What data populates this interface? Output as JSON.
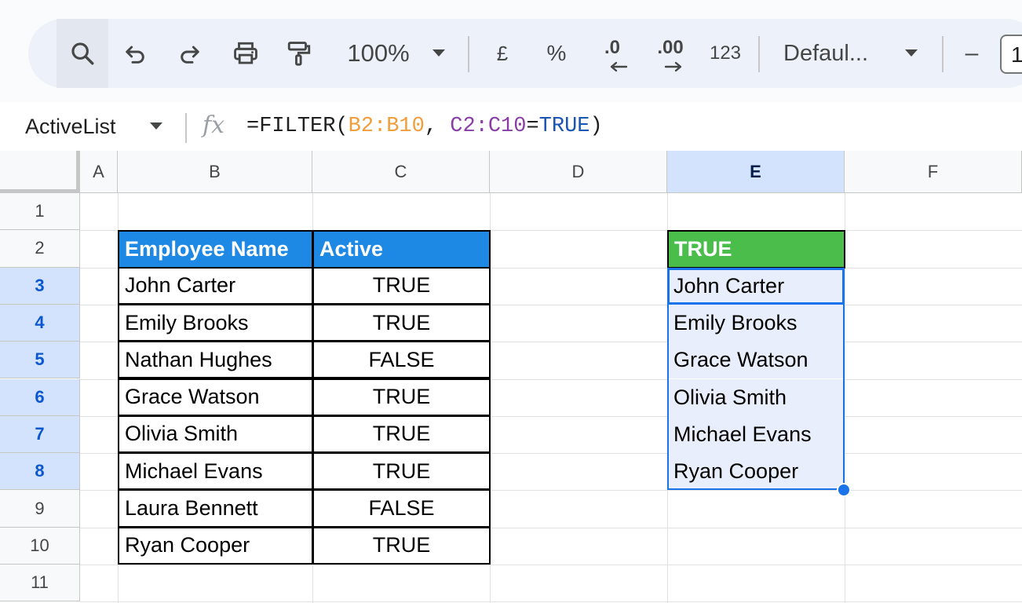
{
  "toolbar": {
    "zoom": "100%",
    "currency": "£",
    "percent": "%",
    "decrease_decimal": ".0",
    "increase_decimal": ".00",
    "number_format": "123",
    "font_name": "Defaul...",
    "font_size": "1",
    "minus": "–"
  },
  "formula_bar": {
    "name_box": "ActiveList",
    "fx": "fx",
    "formula_prefix": "=FILTER(",
    "ref1": "B2:B10",
    "comma": ", ",
    "ref2": "C2:C10",
    "eq": "=",
    "literal": "TRUE",
    "close": ")",
    "colors": {
      "ref1": "#f09d3b",
      "ref2": "#8a3ea5",
      "literal": "#1a55b4"
    }
  },
  "columns": [
    "A",
    "B",
    "C",
    "D",
    "E",
    "F"
  ],
  "rows": [
    "1",
    "2",
    "3",
    "4",
    "5",
    "6",
    "7",
    "8",
    "9",
    "10",
    "11"
  ],
  "source_table": {
    "headers": [
      "Employee Name",
      "Active"
    ],
    "rows": [
      [
        "John Carter",
        "TRUE"
      ],
      [
        "Emily Brooks",
        "TRUE"
      ],
      [
        "Nathan Hughes",
        "FALSE"
      ],
      [
        "Grace Watson",
        "TRUE"
      ],
      [
        "Olivia Smith",
        "TRUE"
      ],
      [
        "Michael Evans",
        "TRUE"
      ],
      [
        "Laura Bennett",
        "FALSE"
      ],
      [
        "Ryan Cooper",
        "TRUE"
      ]
    ],
    "header_color": "#1e88e5"
  },
  "result_table": {
    "header": "TRUE",
    "values": [
      "John Carter",
      "Emily Brooks",
      "Grace Watson",
      "Olivia Smith",
      "Michael Evans",
      "Ryan Cooper"
    ],
    "header_color": "#4bbd4b"
  },
  "selection_color": "#1a73e8"
}
